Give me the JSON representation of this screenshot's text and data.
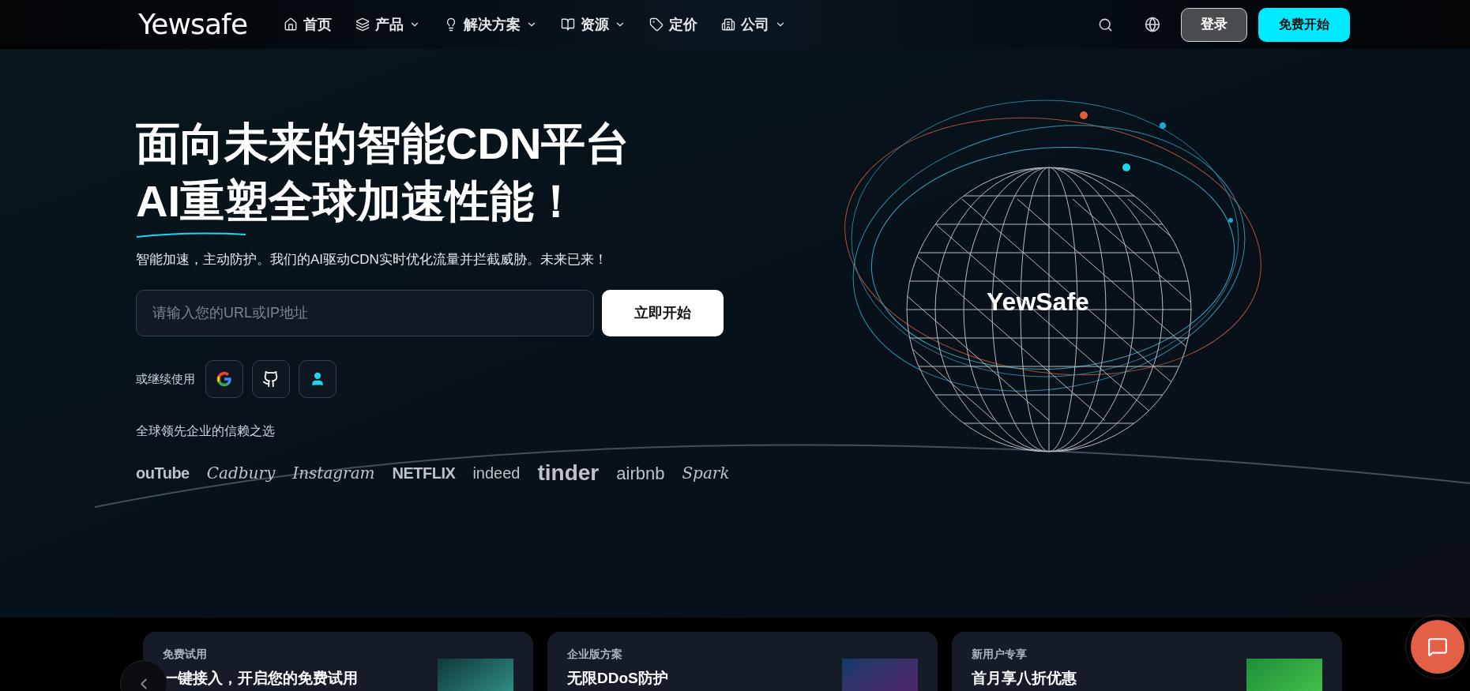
{
  "nav": {
    "logo": "Yewsafe",
    "items": [
      {
        "label": "首页",
        "kind": "home",
        "dropdown": false
      },
      {
        "label": "产品",
        "kind": "layers",
        "dropdown": true
      },
      {
        "label": "解决方案",
        "kind": "bulb",
        "dropdown": true
      },
      {
        "label": "资源",
        "kind": "book",
        "dropdown": true
      },
      {
        "label": "定价",
        "kind": "tag",
        "dropdown": false
      },
      {
        "label": "公司",
        "kind": "building",
        "dropdown": true
      }
    ],
    "login": "登录",
    "cta": "免费开始"
  },
  "hero": {
    "title_lines": [
      "面向未来的智能CDN平台",
      "AI重塑全球加速性能！"
    ],
    "subtitle": "智能加速，主动防护。我们的AI驱动CDN实时优化流量并拦截威胁。未来已来！",
    "input": {
      "placeholder": "请输入您的URL或IP地址"
    },
    "start_button": "立即开始",
    "continue_label": "或继续使用",
    "socials": [
      {
        "kind": "google"
      },
      {
        "kind": "github"
      },
      {
        "kind": "user"
      }
    ],
    "trust_label": "全球领先企业的信赖之选",
    "logos": [
      {
        "text": "ouTube",
        "kind": "bold"
      },
      {
        "text": "Cadbury",
        "kind": "script"
      },
      {
        "text": "Instagram",
        "kind": "script"
      },
      {
        "text": "NETFLIX",
        "kind": "bold"
      },
      {
        "text": "indeed",
        "kind": "plain"
      },
      {
        "text": "tinder",
        "kind": "heavy"
      },
      {
        "text": "airbnb",
        "kind": "airbnb"
      },
      {
        "text": "Spark",
        "kind": "script"
      }
    ],
    "globe_label": "YewSafe"
  },
  "cards": [
    {
      "tag": "免费试用",
      "title": "一键接入，开启您的免费试用",
      "kind": "trial"
    },
    {
      "tag": "企业版方案",
      "title": "无限DDoS防护",
      "kind": "enterprise"
    },
    {
      "tag": "新用户专享",
      "title": "首月享八折优惠",
      "kind": "offer"
    }
  ]
}
